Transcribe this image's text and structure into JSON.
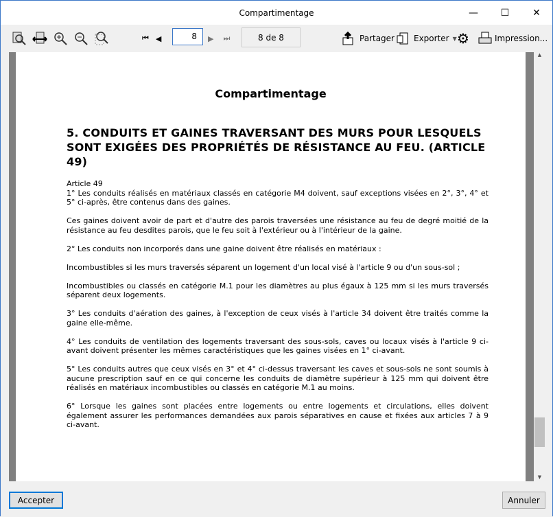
{
  "window": {
    "title": "Compartimentage",
    "minimize": "—",
    "maximize": "☐",
    "close": "✕"
  },
  "toolbar": {
    "page_value": "8",
    "page_count": "8 de 8",
    "share": "Partager",
    "export": "Exporter",
    "print": "Impression..."
  },
  "document": {
    "title": "Compartimentage",
    "section_title": "5. CONDUITS ET GAINES TRAVERSANT DES MURS POUR LESQUELS SONT EXIGÉES DES PROPRIÉTÉS DE RÉSISTANCE AU FEU. (ARTICLE 49)",
    "article": "Article 49",
    "paragraphs": [
      "1° Les conduits réalisés en matériaux classés en catégorie M4 doivent, sauf exceptions visées en 2°, 3°, 4° et 5° ci-après, être contenus dans des gaines.",
      "Ces gaines doivent avoir de part et d'autre des parois traversées une résistance au feu de degré moitié de la résistance au feu desdites parois, que le feu soit à l'extérieur ou à l'intérieur de la gaine.",
      "2° Les conduits non incorporés dans une gaine doivent être réalisés en matériaux :",
      "Incombustibles si les murs traversés séparent un logement d'un local visé à l'article 9 ou d'un sous-sol ;",
      "Incombustibles ou classés en catégorie M.1 pour les diamètres au plus égaux à 125 mm si les murs traversés séparent deux logements.",
      "3° Les conduits d'aération des gaines, à l'exception de ceux visés à l'article 34 doivent être traités comme la gaine elle-même.",
      "4° Les conduits de ventilation des logements traversant des sous-sols, caves ou locaux visés à l'article 9 ci-avant doivent présenter les mêmes caractéristiques que les gaines visées en 1° ci-avant.",
      "5° Les conduits autres que ceux visés en 3° et 4° ci-dessus traversant les caves et sous-sols ne sont soumis à aucune prescription sauf en ce qui concerne les conduits de diamètre supérieur à 125 mm qui doivent être réalisés en matériaux incombustibles ou classés en catégorie M.1 au moins.",
      "6° Lorsque les gaines sont placées entre logements ou entre logements et circulations, elles doivent également assurer les performances demandées aux parois séparatives en cause et fixées aux articles 7 à 9 ci-avant."
    ]
  },
  "footer": {
    "accept": "Accepter",
    "cancel": "Annuler"
  }
}
